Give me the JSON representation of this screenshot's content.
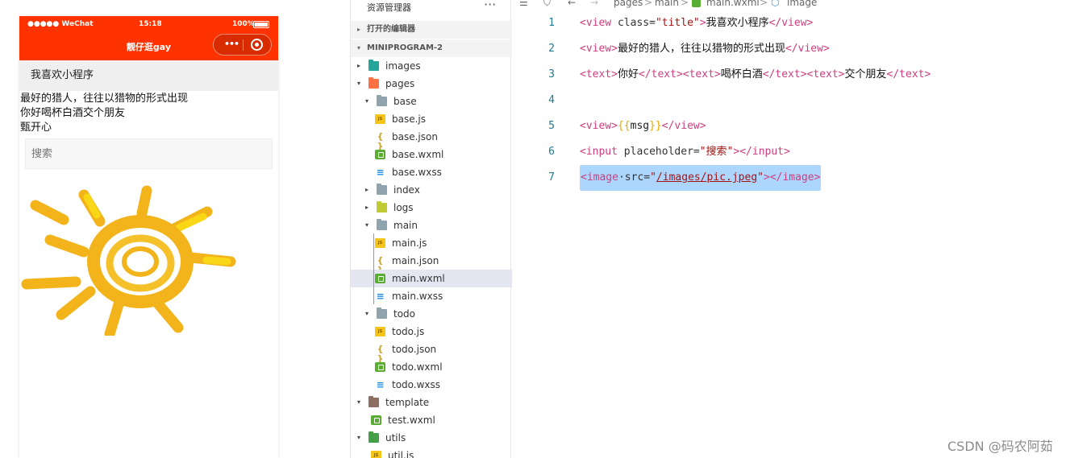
{
  "phone": {
    "status": {
      "carrier": "●●●●● WeChat",
      "time": "15:18",
      "battery": "100%"
    },
    "nav_title": "靓仔逛gay",
    "capsule_dots": "•••",
    "title_bar": "我喜欢小程序",
    "lines": [
      "最好的猎人，往往以猎物的形式出现",
      "你好喝杯白酒交个朋友",
      "甄开心"
    ],
    "input_placeholder": "搜索",
    "image_icon": "sun-image",
    "colors": {
      "nav": "#ff3300",
      "sun": "#f2b41a"
    }
  },
  "explorer": {
    "header": "资源管理器",
    "more": "···",
    "open_editors": "打开的编辑器",
    "project": "MINIPROGRAM-2",
    "tree": [
      {
        "name": "images",
        "type": "folder-img",
        "depth": 1,
        "caret": "▸"
      },
      {
        "name": "pages",
        "type": "folder-pages",
        "depth": 1,
        "caret": "▾"
      },
      {
        "name": "base",
        "type": "folder",
        "depth": 2,
        "caret": "▾"
      },
      {
        "name": "base.js",
        "type": "js",
        "depth": 3,
        "caret": ""
      },
      {
        "name": "base.json",
        "type": "json",
        "depth": 3,
        "caret": ""
      },
      {
        "name": "base.wxml",
        "type": "wxml",
        "depth": 3,
        "caret": ""
      },
      {
        "name": "base.wxss",
        "type": "wxss",
        "depth": 3,
        "caret": ""
      },
      {
        "name": "index",
        "type": "folder",
        "depth": 2,
        "caret": "▸"
      },
      {
        "name": "logs",
        "type": "folder-logs",
        "depth": 2,
        "caret": "▸"
      },
      {
        "name": "main",
        "type": "folder",
        "depth": 2,
        "caret": "▾"
      },
      {
        "name": "main.js",
        "type": "js",
        "depth": 3,
        "caret": ""
      },
      {
        "name": "main.json",
        "type": "json",
        "depth": 3,
        "caret": ""
      },
      {
        "name": "main.wxml",
        "type": "wxml",
        "depth": 3,
        "caret": "",
        "selected": true
      },
      {
        "name": "main.wxss",
        "type": "wxss",
        "depth": 3,
        "caret": ""
      },
      {
        "name": "todo",
        "type": "folder",
        "depth": 2,
        "caret": "▾"
      },
      {
        "name": "todo.js",
        "type": "js",
        "depth": 3,
        "caret": ""
      },
      {
        "name": "todo.json",
        "type": "json",
        "depth": 3,
        "caret": ""
      },
      {
        "name": "todo.wxml",
        "type": "wxml",
        "depth": 3,
        "caret": ""
      },
      {
        "name": "todo.wxss",
        "type": "wxss",
        "depth": 3,
        "caret": ""
      },
      {
        "name": "template",
        "type": "folder-template",
        "depth": 1,
        "caret": "▾"
      },
      {
        "name": "test.wxml",
        "type": "wxml",
        "depth": 2,
        "caret": ""
      },
      {
        "name": "utils",
        "type": "folder-utils",
        "depth": 1,
        "caret": "▾"
      },
      {
        "name": "util.js",
        "type": "js",
        "depth": 2,
        "caret": ""
      }
    ]
  },
  "editor": {
    "breadcrumb": {
      "list_icon": "list-icon",
      "bookmark_icon": "bookmark-icon",
      "back": "←",
      "forward": "→",
      "path": [
        "pages",
        "main",
        "main.wxml",
        "image"
      ],
      "sep": ">"
    },
    "lines": [
      {
        "n": "1",
        "parts": [
          [
            "tag",
            "<view "
          ],
          [
            "attr",
            "class="
          ],
          [
            "str",
            "\"title\""
          ],
          [
            "tag",
            ">"
          ],
          [
            "txt",
            "我喜欢小程序"
          ],
          [
            "tag",
            "</view>"
          ]
        ]
      },
      {
        "n": "2",
        "parts": [
          [
            "tag",
            "<view>"
          ],
          [
            "txt",
            "最好的猎人，往往以猎物的形式出现"
          ],
          [
            "tag",
            "</view>"
          ]
        ]
      },
      {
        "n": "3",
        "parts": [
          [
            "tag",
            "<text>"
          ],
          [
            "txt",
            "你好"
          ],
          [
            "tag",
            "</text><text>"
          ],
          [
            "txt",
            "喝杯白酒"
          ],
          [
            "tag",
            "</text><text>"
          ],
          [
            "txt",
            "交个朋友"
          ],
          [
            "tag",
            "</text>"
          ]
        ]
      },
      {
        "n": "4",
        "parts": []
      },
      {
        "n": "5",
        "parts": [
          [
            "tag",
            "<view>"
          ],
          [
            "brace",
            "{{"
          ],
          [
            "var",
            "msg"
          ],
          [
            "brace",
            "}}"
          ],
          [
            "tag",
            "</view>"
          ]
        ]
      },
      {
        "n": "6",
        "parts": [
          [
            "tag",
            "<input "
          ],
          [
            "attr",
            "placeholder="
          ],
          [
            "str",
            "\""
          ],
          [
            "txtstr",
            "搜索"
          ],
          [
            "str",
            "\""
          ],
          [
            "tag",
            "></input>"
          ]
        ]
      },
      {
        "n": "7",
        "selected": true,
        "parts": [
          [
            "tag",
            "<image"
          ],
          [
            "attr",
            "·src="
          ],
          [
            "str",
            "\""
          ],
          [
            "link",
            "/images/pic.jpeg"
          ],
          [
            "str",
            "\""
          ],
          [
            "tag",
            "></image>"
          ]
        ]
      }
    ]
  },
  "watermark": "CSDN @码农阿茹"
}
